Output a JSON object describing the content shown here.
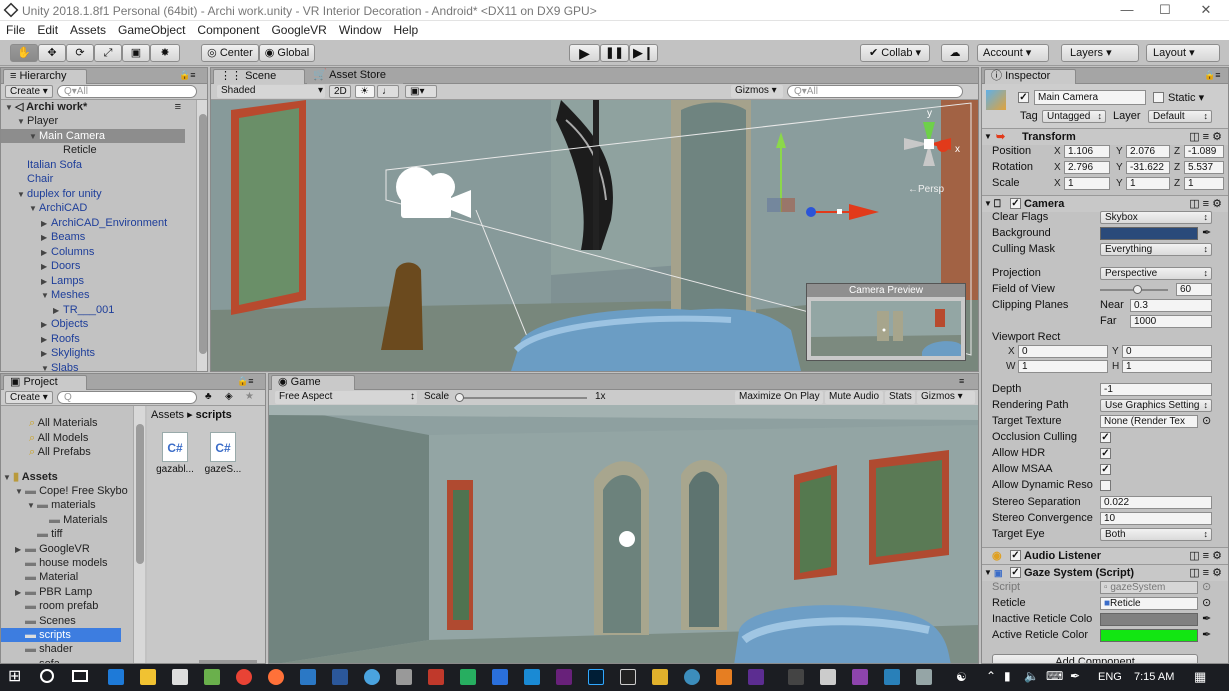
{
  "window": {
    "title": "Unity 2018.1.8f1 Personal (64bit) - Archi work.unity - VR Interior Decoration - Android* <DX11 on DX9 GPU>",
    "min": "—",
    "max": "☐",
    "close": "✕"
  },
  "menu": [
    "File",
    "Edit",
    "Assets",
    "GameObject",
    "Component",
    "GoogleVR",
    "Window",
    "Help"
  ],
  "toolbar": {
    "pivot": "Center",
    "space": "Global",
    "collab": "Collab ▾",
    "account": "Account",
    "layers": "Layers",
    "layout": "Layout"
  },
  "hierarchy": {
    "tab": "Hierarchy",
    "create": "Create ▾",
    "search_placeholder": "Q▾All",
    "scene": "Archi work*",
    "rows": [
      {
        "label": "Player",
        "indent": 1,
        "arrow": "▼"
      },
      {
        "label": "Main Camera",
        "indent": 2,
        "arrow": "▼",
        "selected": true
      },
      {
        "label": "Reticle",
        "indent": 4,
        "arrow": ""
      },
      {
        "label": "Italian Sofa",
        "indent": 1,
        "arrow": "",
        "blue": true
      },
      {
        "label": "Chair",
        "indent": 1,
        "arrow": "",
        "blue": true
      },
      {
        "label": "duplex for unity",
        "indent": 1,
        "arrow": "▼",
        "blue": true
      },
      {
        "label": "ArchiCAD",
        "indent": 2,
        "arrow": "▼",
        "blue": true
      },
      {
        "label": "ArchiCAD_Environment",
        "indent": 3,
        "arrow": "▶",
        "blue": true
      },
      {
        "label": "Beams",
        "indent": 3,
        "arrow": "▶",
        "blue": true
      },
      {
        "label": "Columns",
        "indent": 3,
        "arrow": "▶",
        "blue": true
      },
      {
        "label": "Doors",
        "indent": 3,
        "arrow": "▶",
        "blue": true
      },
      {
        "label": "Lamps",
        "indent": 3,
        "arrow": "▶",
        "blue": true
      },
      {
        "label": "Meshes",
        "indent": 3,
        "arrow": "▼",
        "blue": true
      },
      {
        "label": "TR___001",
        "indent": 4,
        "arrow": "▶",
        "blue": true
      },
      {
        "label": "Objects",
        "indent": 3,
        "arrow": "▶",
        "blue": true
      },
      {
        "label": "Roofs",
        "indent": 3,
        "arrow": "▶",
        "blue": true
      },
      {
        "label": "Skylights",
        "indent": 3,
        "arrow": "▶",
        "blue": true
      },
      {
        "label": "Slabs",
        "indent": 3,
        "arrow": "▼",
        "blue": true
      }
    ]
  },
  "scene": {
    "tab": "Scene",
    "tab2": "Asset Store",
    "shading": "Shaded",
    "mode2d": "2D",
    "gizmos": "Gizmos ▾",
    "search_placeholder": "Q▾All",
    "persp": "←Persp",
    "preview_title": "Camera Preview",
    "axis_y": "y",
    "axis_x": "x"
  },
  "game": {
    "tab": "Game",
    "aspect": "Free Aspect",
    "scale_label": "Scale",
    "scale_value": "1x",
    "maximize": "Maximize On Play",
    "mute": "Mute Audio",
    "stats": "Stats",
    "gizmos": "Gizmos ▾"
  },
  "project": {
    "tab": "Project",
    "create": "Create ▾",
    "search_placeholder": "Q",
    "favorites": [
      "All Materials",
      "All Models",
      "All Prefabs"
    ],
    "assets_label": "Assets",
    "tree": [
      {
        "label": "Cope! Free Skybo",
        "indent": 1,
        "arrow": "▼"
      },
      {
        "label": "materials",
        "indent": 2,
        "arrow": "▼"
      },
      {
        "label": "Materials",
        "indent": 3,
        "arrow": ""
      },
      {
        "label": "tiff",
        "indent": 2,
        "arrow": ""
      },
      {
        "label": "GoogleVR",
        "indent": 1,
        "arrow": "▶"
      },
      {
        "label": "house models",
        "indent": 1,
        "arrow": ""
      },
      {
        "label": "Material",
        "indent": 1,
        "arrow": ""
      },
      {
        "label": "PBR Lamp",
        "indent": 1,
        "arrow": "▶"
      },
      {
        "label": "room prefab",
        "indent": 1,
        "arrow": ""
      },
      {
        "label": "Scenes",
        "indent": 1,
        "arrow": ""
      },
      {
        "label": "scripts",
        "indent": 1,
        "arrow": "",
        "selected": true
      },
      {
        "label": "shader",
        "indent": 1,
        "arrow": ""
      },
      {
        "label": "sofa",
        "indent": 1,
        "arrow": ""
      }
    ],
    "breadcrumb_root": "Assets",
    "breadcrumb_sep": "▸",
    "breadcrumb_leaf": "scripts",
    "files": [
      {
        "name": "gazabl...",
        "icon": "C#"
      },
      {
        "name": "gazeS...",
        "icon": "C#"
      }
    ]
  },
  "inspector": {
    "tab": "Inspector",
    "object_name": "Main Camera",
    "static": "Static ▾",
    "tag_label": "Tag",
    "tag": "Untagged",
    "layer_label": "Layer",
    "layer": "Default",
    "transform": {
      "title": "Transform",
      "position": {
        "label": "Position",
        "x": "1.106",
        "y": "2.076",
        "z": "-1.089"
      },
      "rotation": {
        "label": "Rotation",
        "x": "2.796",
        "y": "-31.622",
        "z": "5.537"
      },
      "scale": {
        "label": "Scale",
        "x": "1",
        "y": "1",
        "z": "1"
      }
    },
    "camera": {
      "title": "Camera",
      "clear_flags": {
        "label": "Clear Flags",
        "value": "Skybox"
      },
      "background": {
        "label": "Background",
        "color": "#2a4a7a"
      },
      "culling_mask": {
        "label": "Culling Mask",
        "value": "Everything"
      },
      "projection": {
        "label": "Projection",
        "value": "Perspective"
      },
      "fov": {
        "label": "Field of View",
        "value": "60",
        "fraction": 0.55
      },
      "clipping": {
        "label": "Clipping Planes",
        "near_label": "Near",
        "near": "0.3",
        "far_label": "Far",
        "far": "1000"
      },
      "viewport": {
        "label": "Viewport Rect",
        "x": "0",
        "y": "0",
        "w": "1",
        "h": "1"
      },
      "depth": {
        "label": "Depth",
        "value": "-1"
      },
      "rendering_path": {
        "label": "Rendering Path",
        "value": "Use Graphics Setting"
      },
      "target_texture": {
        "label": "Target Texture",
        "value": "None (Render Tex"
      },
      "occlusion": {
        "label": "Occlusion Culling",
        "checked": true
      },
      "hdr": {
        "label": "Allow HDR",
        "checked": true
      },
      "msaa": {
        "label": "Allow MSAA",
        "checked": true
      },
      "dynamic": {
        "label": "Allow Dynamic Reso",
        "checked": false
      },
      "stereo_sep": {
        "label": "Stereo Separation",
        "value": "0.022"
      },
      "stereo_conv": {
        "label": "Stereo Convergence",
        "value": "10"
      },
      "target_eye": {
        "label": "Target Eye",
        "value": "Both"
      }
    },
    "audio_listener": {
      "title": "Audio Listener"
    },
    "gaze": {
      "title": "Gaze System (Script)",
      "script": {
        "label": "Script",
        "value": "▫ gazeSystem"
      },
      "reticle": {
        "label": "Reticle",
        "value": "Reticle"
      },
      "inactive": {
        "label": "Inactive Reticle Colo",
        "color": "#808080"
      },
      "active": {
        "label": "Active Reticle Color",
        "color": "#12e612"
      }
    },
    "add_component": "Add Component"
  },
  "taskbar": {
    "lang": "ENG",
    "time": "7:15 AM"
  }
}
